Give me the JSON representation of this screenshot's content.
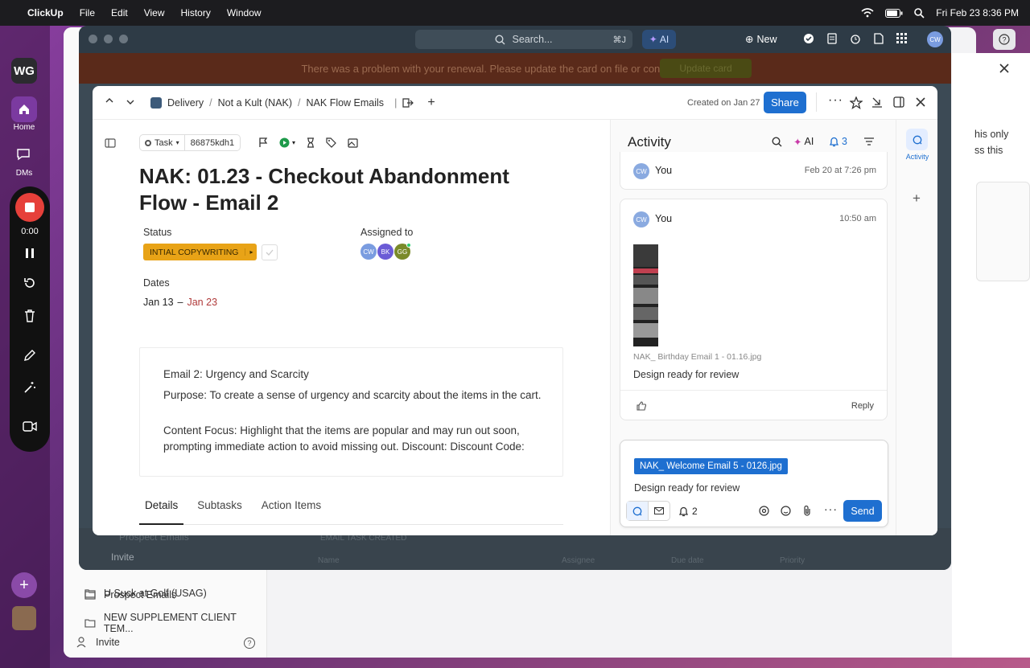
{
  "menubar": {
    "app": "ClickUp",
    "items": [
      "File",
      "Edit",
      "View",
      "History",
      "Window"
    ],
    "clock": "Fri Feb 23  8:36 PM"
  },
  "dock": {
    "workspace": "WG",
    "home": "Home",
    "dms": "DMs",
    "timer": "0:00"
  },
  "background_window": {
    "sidebar_items": [
      "U Suck at Golf (USAG)",
      "Prospect Emails",
      "NEW SUPPLEMENT CLIENT TEM..."
    ],
    "invite": "Invite",
    "right_text_1": "his only",
    "right_text_2": "ss this"
  },
  "dark_window": {
    "search": "Search...",
    "search_shortcut": "⌘J",
    "ai": "AI",
    "new": "New",
    "banner": "There was a problem with your renewal. Please update the card on file or contact your bank.",
    "banner_button": "Update card",
    "behind_rows": [
      "Prospect Emails",
      "EMAIL TASK CREATED"
    ],
    "behind_invite": "Invite",
    "table_headers": [
      "Name",
      "Assignee",
      "Due date",
      "Priority"
    ]
  },
  "modal": {
    "breadcrumb": [
      "Delivery",
      "Not a Kult (NAK)",
      "NAK Flow Emails"
    ],
    "created": "Created on Jan 27",
    "share": "Share",
    "task_type": "Task",
    "task_id": "86875kdh1",
    "title": "NAK: 01.23 - Checkout Abandonment Flow - Email 2",
    "status_label": "Status",
    "status_value": "INTIAL COPYWRITING",
    "assigned_label": "Assigned to",
    "assignees": [
      {
        "initials": "CW",
        "color": "#7a9ce0"
      },
      {
        "initials": "BK",
        "color": "#6b5bd6"
      },
      {
        "initials": "GG",
        "color": "#7a8a2a"
      }
    ],
    "dates_label": "Dates",
    "date_start": "Jan 13",
    "date_sep": "–",
    "date_end": "Jan 23",
    "description": [
      "Email 2: Urgency and Scarcity",
      "Purpose: To create a sense of urgency and scarcity about the items in the cart.",
      "Content Focus: Highlight that the items are popular and may run out soon, prompting immediate action to avoid missing out. Discount:  Discount Code:"
    ],
    "tabs": [
      "Details",
      "Subtasks",
      "Action Items"
    ],
    "activity": {
      "title": "Activity",
      "ai": "AI",
      "bell_count": "3",
      "sidebar_label": "Activity",
      "comment1": {
        "avatar": "CW",
        "user": "You",
        "time": "Feb 20 at 7:26 pm"
      },
      "comment2": {
        "avatar": "CW",
        "user": "You",
        "time": "10:50 am",
        "file": "NAK_ Birthday Email 1 - 01.16.jpg",
        "text": "Design ready for review",
        "reply": "Reply"
      },
      "composer": {
        "chip": "NAK_ Welcome Email 5 - 0126.jpg",
        "text": "Design ready for review",
        "bell_count": "2",
        "send": "Send"
      }
    }
  },
  "colors": {
    "status": "#e8a317",
    "accent": "#1e6fd0",
    "date_end": "#b03a3a"
  }
}
